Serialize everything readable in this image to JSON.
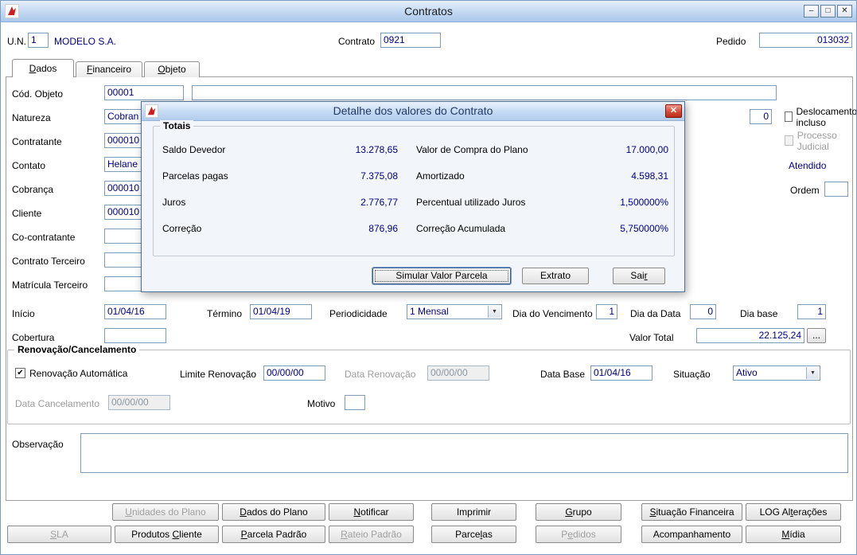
{
  "titlebar": {
    "title": "Contratos"
  },
  "icons": {
    "minimize": "–",
    "maximize": "□",
    "close": "✕",
    "dropdown": "▼",
    "check": "✔"
  },
  "header": {
    "un_label": "U.N.",
    "un_value": "1",
    "company": "MODELO S.A.",
    "contrato_label": "Contrato",
    "contrato_value": "0921",
    "pedido_label": "Pedido",
    "pedido_value": "013032"
  },
  "tabs": [
    {
      "html": "<u>D</u>ados"
    },
    {
      "html": "<u>F</u>inanceiro"
    },
    {
      "html": "<u>O</u>bjeto"
    }
  ],
  "form": {
    "cod_objeto": {
      "label": "Cód. Objeto",
      "value": "00001",
      "desc": ""
    },
    "natureza": {
      "label": "Natureza",
      "value": "Cobran"
    },
    "contratante": {
      "label": "Contratante",
      "value": "000010"
    },
    "contato": {
      "label": "Contato",
      "value": "Helane"
    },
    "cobranca": {
      "label": "Cobrança",
      "value": "000010"
    },
    "cliente": {
      "label": "Cliente",
      "value": "000010"
    },
    "cocontratante": {
      "label": "Co-contratante",
      "value": ""
    },
    "contrato_terceiro": {
      "label": "Contrato Terceiro",
      "value": ""
    },
    "matricula_terceiro": {
      "label": "Matrícula Terceiro",
      "value": ""
    },
    "right": {
      "mini_value": "0",
      "deslocamento": "Deslocamento incluso",
      "processo": "Processo Judicial",
      "atendido": "Atendido",
      "ordem_label": "Ordem",
      "ordem_value": ""
    },
    "inicio": {
      "label": "Início",
      "value": "01/04/16"
    },
    "termino": {
      "label": "Término",
      "value": "01/04/19"
    },
    "periodicidade": {
      "label": "Periodicidade",
      "value": "1 Mensal"
    },
    "dia_vencimento": {
      "label": "Dia do Vencimento",
      "value": "1"
    },
    "dia_data": {
      "label": "Dia da Data",
      "value": "0"
    },
    "dia_base": {
      "label": "Dia base",
      "value": "1"
    },
    "cobertura": {
      "label": "Cobertura",
      "value": ""
    },
    "valor_total": {
      "label": "Valor Total",
      "value": "22.125,24",
      "more": "..."
    }
  },
  "renewal": {
    "title": "Renovação/Cancelamento",
    "auto_label": "Renovação Automática",
    "limite": {
      "label": "Limite Renovação",
      "value": "00/00/00"
    },
    "data_renovacao": {
      "label": "Data Renovação",
      "value": "00/00/00"
    },
    "data_base": {
      "label": "Data Base",
      "value": "01/04/16"
    },
    "situacao": {
      "label": "Situação",
      "value": "Ativo"
    },
    "data_cancelamento": {
      "label": "Data Cancelamento",
      "value": "00/00/00"
    },
    "motivo": {
      "label": "Motivo",
      "value": ""
    }
  },
  "observacao": {
    "label": "Observação",
    "value": ""
  },
  "footer": {
    "row1": [
      {
        "html": "<u>U</u>nidades do Plano"
      },
      {
        "html": "<u>D</u>ados do Plano"
      },
      {
        "html": "<u>N</u>otificar"
      },
      {
        "html": "Imprimir"
      },
      {
        "html": "<u>G</u>rupo"
      },
      {
        "html": "<u>S</u>ituação Financeira"
      },
      {
        "html": "LOG Al<u>t</u>erações"
      }
    ],
    "row2": [
      {
        "html": "<u>S</u>LA"
      },
      {
        "html": "Produtos <u>C</u>liente"
      },
      {
        "html": "<u>P</u>arcela Padrão"
      },
      {
        "html": "<u>R</u>ateio Padrão"
      },
      {
        "html": "Parce<u>l</u>as"
      },
      {
        "html": "P<u>e</u>didos"
      },
      {
        "html": "Acompanhamento"
      },
      {
        "html": "<u>M</u>ídia"
      }
    ]
  },
  "dialog": {
    "title": "Detalhe dos valores do Contrato",
    "group_title": "Totais",
    "rows": [
      {
        "l_label": "Saldo Devedor",
        "l_value": "13.278,65",
        "r_label": "Valor de Compra do Plano",
        "r_value": "17.000,00"
      },
      {
        "l_label": "Parcelas pagas",
        "l_value": "7.375,08",
        "r_label": "Amortizado",
        "r_value": "4.598,31"
      },
      {
        "l_label": "Juros",
        "l_value": "2.776,77",
        "r_label": "Percentual utilizado Juros",
        "r_value": "1,500000%"
      },
      {
        "l_label": "Correção",
        "l_value": "876,96",
        "r_label": "Correção Acumulada",
        "r_value": "5,750000%"
      }
    ],
    "buttons": [
      {
        "html": "Simular Valor Parcela"
      },
      {
        "html": "Extrato"
      },
      {
        "html": "Sai<u>r</u>"
      }
    ]
  }
}
